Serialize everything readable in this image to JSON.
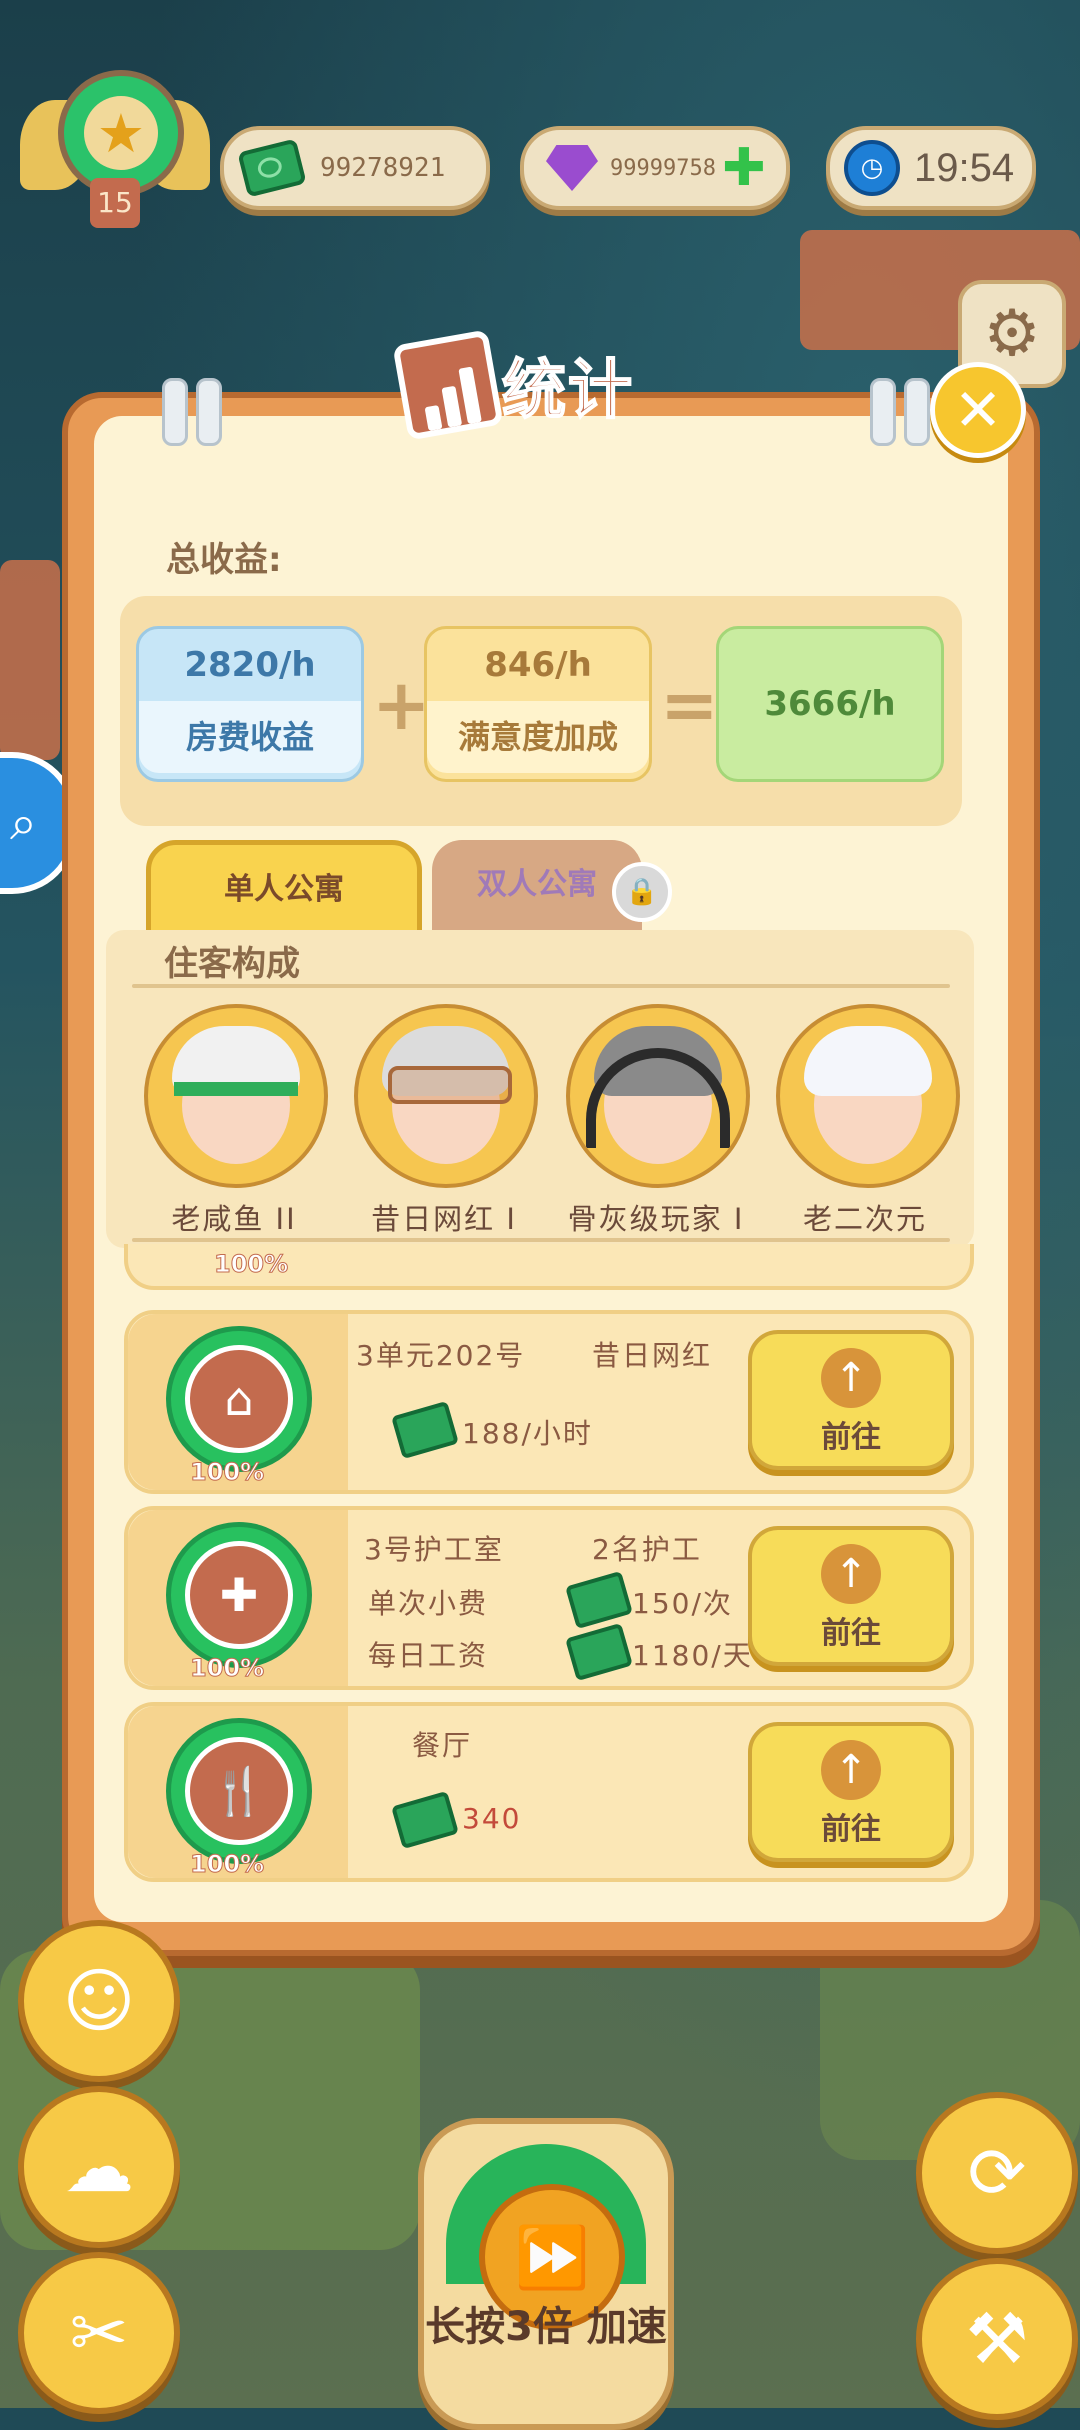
{
  "hud": {
    "level": "15",
    "cash": "99278921",
    "gems": "99999758",
    "time": "19:54"
  },
  "panel": {
    "title": "统计",
    "income_label": "总收益:",
    "rent_value": "2820/h",
    "rent_label": "房费收益",
    "satisfaction_value": "846/h",
    "satisfaction_label": "满意度加成",
    "total_value": "3666/h",
    "tab_single": "单人公寓",
    "tab_double": "双人公寓",
    "guest_title": "住客构成"
  },
  "guests": [
    {
      "name": "老咸鱼 II"
    },
    {
      "name": "昔日网红 I"
    },
    {
      "name": "骨灰级玩家 I"
    },
    {
      "name": "老二次元"
    }
  ],
  "partial_card_pct": "100%",
  "cards": [
    {
      "pct": "100%",
      "title": "3单元202号",
      "tag": "昔日网红",
      "line1": "188/小时",
      "go": "前往"
    },
    {
      "pct": "100%",
      "title": "3号护工室",
      "tag": "2名护工",
      "label_a": "单次小费",
      "value_a": "150/次",
      "label_b": "每日工资",
      "value_b": "1180/天",
      "go": "前往"
    },
    {
      "pct": "100%",
      "title": "餐厅",
      "line1": "340",
      "go": "前往"
    }
  ],
  "speed_button": "长按3倍 加速",
  "colors": {
    "rent_bg": "#c7e6f7",
    "satisfaction_bg": "#fbe29b",
    "total_bg": "#c9eca0",
    "accent": "#c36b4e",
    "go_button": "#f7dc59"
  }
}
